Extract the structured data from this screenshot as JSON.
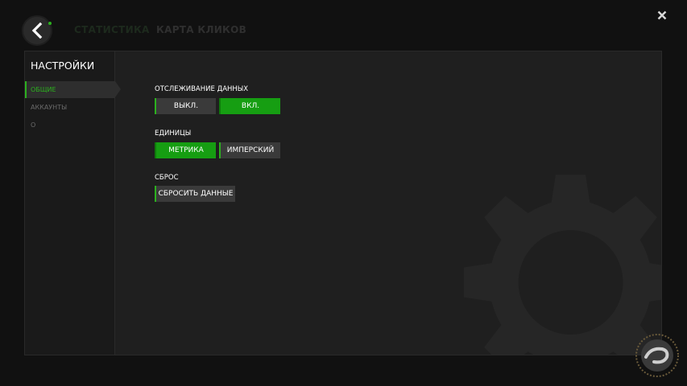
{
  "header": {
    "tabs": [
      {
        "label": "СТАТИСТИКА"
      },
      {
        "label": "КАРТА КЛИКОВ"
      }
    ]
  },
  "sidebar": {
    "title": "НАСТРОЙКИ",
    "items": [
      {
        "label": "ОБЩИЕ",
        "active": true
      },
      {
        "label": "АККАУНТЫ",
        "active": false
      },
      {
        "label": "О",
        "active": false
      }
    ]
  },
  "settings": {
    "tracking": {
      "label": "ОТСЛЕЖИВАНИЕ ДАННЫХ",
      "off_label": "ВЫКЛ.",
      "on_label": "ВКЛ.",
      "selected": "ВКЛ."
    },
    "units": {
      "label": "ЕДИНИЦЫ",
      "metric_label": "МЕТРИКА",
      "imperial_label": "ИМПЕРСКИЙ",
      "selected": "МЕТРИКА"
    },
    "reset": {
      "label": "СБРОС",
      "button_label": "СБРОСИТЬ ДАННЫЕ"
    }
  },
  "colors": {
    "accent": "#2bb01e",
    "selected_button": "#169e12",
    "background": "#111111",
    "panel": "#1f1f1f"
  },
  "icons": [
    "back-arrow-icon",
    "close-icon",
    "gear-icon"
  ]
}
